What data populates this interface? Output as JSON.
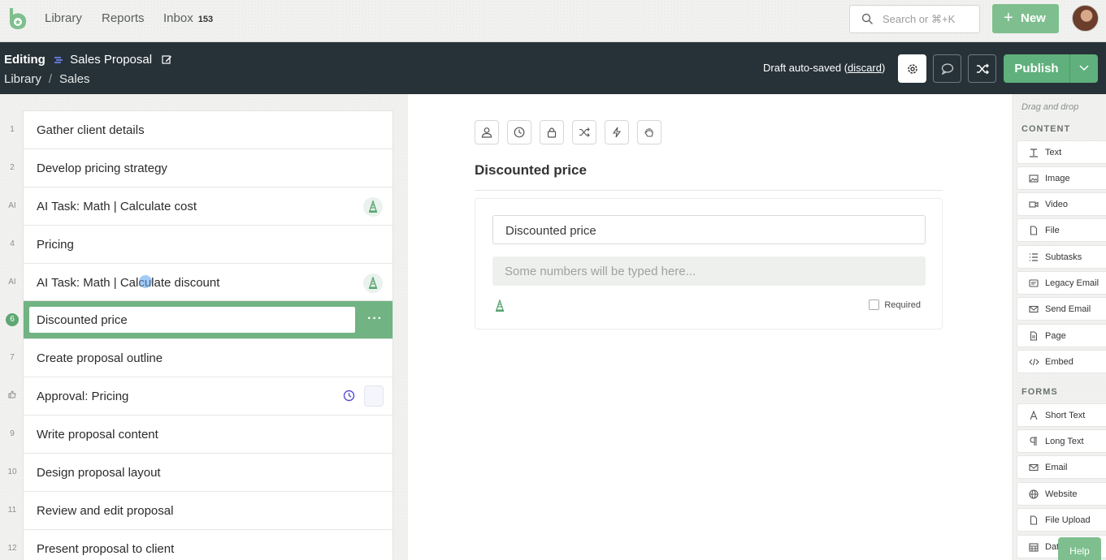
{
  "nav": {
    "links": [
      "Library",
      "Reports",
      "Inbox"
    ],
    "inbox_count": "153",
    "search_placeholder": "Search or ⌘+K",
    "new_label": "New"
  },
  "header": {
    "mode": "Editing",
    "workflow_name": "Sales Proposal",
    "breadcrumb": [
      "Library",
      "Sales"
    ],
    "draft_text": "Draft auto-saved (",
    "discard_label": "discard",
    "draft_close": ")",
    "publish_label": "Publish"
  },
  "tasks": [
    {
      "num": "1",
      "label": "Gather client details"
    },
    {
      "num": "2",
      "label": "Develop pricing strategy"
    },
    {
      "num": "AI",
      "label": "AI Task: Math | Calculate cost",
      "ai": true
    },
    {
      "num": "4",
      "label": "Pricing"
    },
    {
      "num": "AI",
      "label": "AI Task: Math | Calculate discount",
      "ai": true
    },
    {
      "num": "6",
      "label": "Discounted price",
      "active": true
    },
    {
      "num": "7",
      "label": "Create proposal outline"
    },
    {
      "num": "",
      "label": "Approval: Pricing",
      "approval": true
    },
    {
      "num": "9",
      "label": "Write proposal content"
    },
    {
      "num": "10",
      "label": "Design proposal layout"
    },
    {
      "num": "11",
      "label": "Review and edit proposal"
    },
    {
      "num": "12",
      "label": "Present proposal to client"
    }
  ],
  "editor": {
    "field_title": "Discounted price",
    "label_value": "Discounted price",
    "input_placeholder": "Some numbers will be typed here...",
    "required_label": "Required"
  },
  "palette": {
    "hint": "Drag and drop",
    "content_title": "CONTENT",
    "content_items": [
      "Text",
      "Image",
      "Video",
      "File",
      "Subtasks",
      "Legacy Email",
      "Send Email",
      "Page",
      "Embed"
    ],
    "forms_title": "FORMS",
    "form_items": [
      "Short Text",
      "Long Text",
      "Email",
      "Website",
      "File Upload",
      "Dat"
    ],
    "help_label": "Help"
  },
  "colors": {
    "accent": "#7fbf8f",
    "header_bg": "#263238",
    "active_row": "#71b383"
  }
}
